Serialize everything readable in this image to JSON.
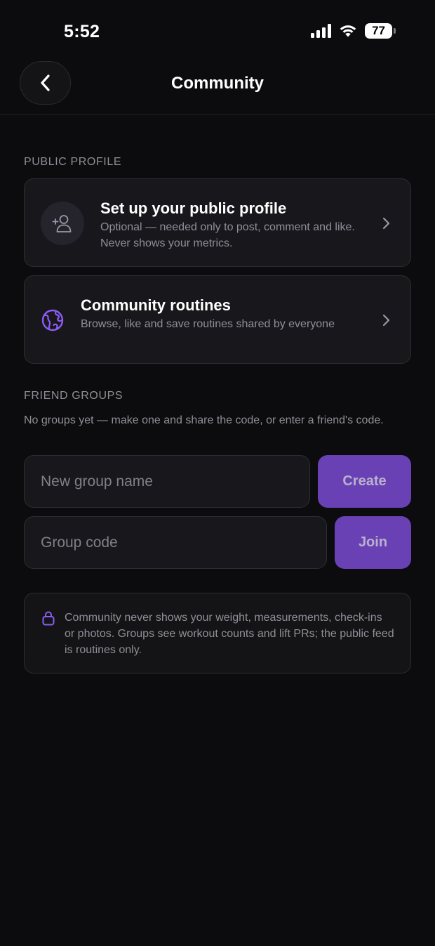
{
  "status_bar": {
    "time": "5:52",
    "battery": "77",
    "icons": [
      "signal-icon",
      "wifi-icon",
      "battery-icon"
    ]
  },
  "header": {
    "title": "Community",
    "back_icon": "chevron-left-icon"
  },
  "public_profile": {
    "section_label": "PUBLIC PROFILE",
    "profile_card": {
      "title": "Set up your public profile",
      "subtitle": "Optional — needed only to post, comment and like. Never shows your metrics.",
      "icon": "add-person-icon"
    },
    "routines_card": {
      "title": "Community routines",
      "subtitle": "Browse, like and save routines shared by everyone",
      "icon": "globe-icon"
    }
  },
  "friend_groups": {
    "section_label": "FRIEND GROUPS",
    "hint": "No groups yet — make one and share the code, or enter a friend's code.",
    "new_group_placeholder": "New group name",
    "new_group_value": "",
    "create_label": "Create",
    "group_code_placeholder": "Group code",
    "group_code_value": "",
    "join_label": "Join"
  },
  "privacy_note": {
    "icon": "lock-icon",
    "text": "Community never shows your weight, measurements, check-ins or photos. Groups see workout counts and lift PRs; the public feed is routines only."
  },
  "colors": {
    "background": "#0c0c0e",
    "card": "#18181c",
    "accent": "#6941b5",
    "accent_icon": "#8b5cf6",
    "muted_text": "#8e8e98"
  }
}
